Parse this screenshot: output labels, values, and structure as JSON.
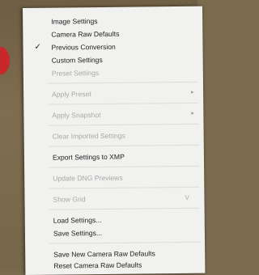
{
  "menu": {
    "items": [
      {
        "label": "Image Settings",
        "enabled": true
      },
      {
        "label": "Camera Raw Defaults",
        "enabled": true
      },
      {
        "label": "Previous Conversion",
        "enabled": true,
        "checked": true,
        "check_glyph": "✓"
      },
      {
        "label": "Custom Settings",
        "enabled": true
      },
      {
        "label": "Preset Settings",
        "enabled": false
      },
      {
        "label": "Apply Preset",
        "enabled": false,
        "submenu_glyph": "▸"
      },
      {
        "label": "Apply Snapshot",
        "enabled": false,
        "submenu_glyph": "▸"
      },
      {
        "label": "Clear Imported Settings",
        "enabled": false
      },
      {
        "label": "Export Settings to XMP",
        "enabled": true
      },
      {
        "label": "Update DNG Previews",
        "enabled": false
      },
      {
        "label": "Show Grid",
        "enabled": false,
        "shortcut": "V"
      },
      {
        "label": "Load Settings...",
        "enabled": true
      },
      {
        "label": "Save Settings...",
        "enabled": true
      },
      {
        "label": "Save New Camera Raw Defaults",
        "enabled": true
      },
      {
        "label": "Reset Camera Raw Defaults",
        "enabled": true
      }
    ]
  }
}
